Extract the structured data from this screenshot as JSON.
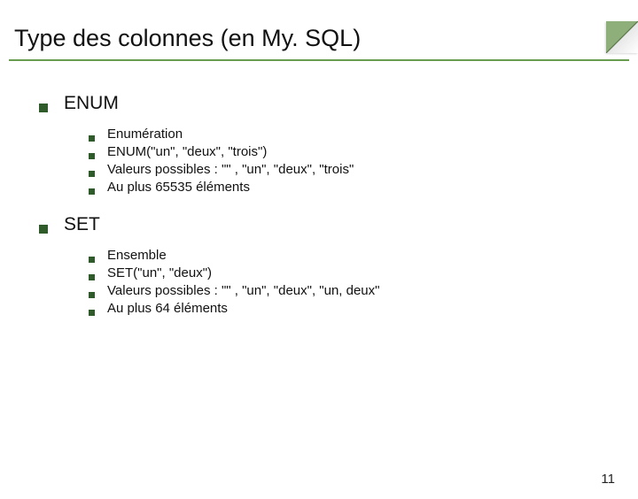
{
  "title": "Type des colonnes (en My. SQL)",
  "sections": [
    {
      "heading": "ENUM",
      "items": [
        "Enumération",
        "ENUM(\"un\", \"deux\", \"trois\")",
        "Valeurs possibles : \"\" , \"un\", \"deux\", \"trois\"",
        "Au plus 65535 éléments"
      ]
    },
    {
      "heading": "SET",
      "items": [
        "Ensemble",
        "SET(\"un\", \"deux\")",
        "Valeurs possibles : \"\" , \"un\", \"deux\", \"un, deux\"",
        "Au plus 64 éléments"
      ]
    }
  ],
  "page_number": "11"
}
